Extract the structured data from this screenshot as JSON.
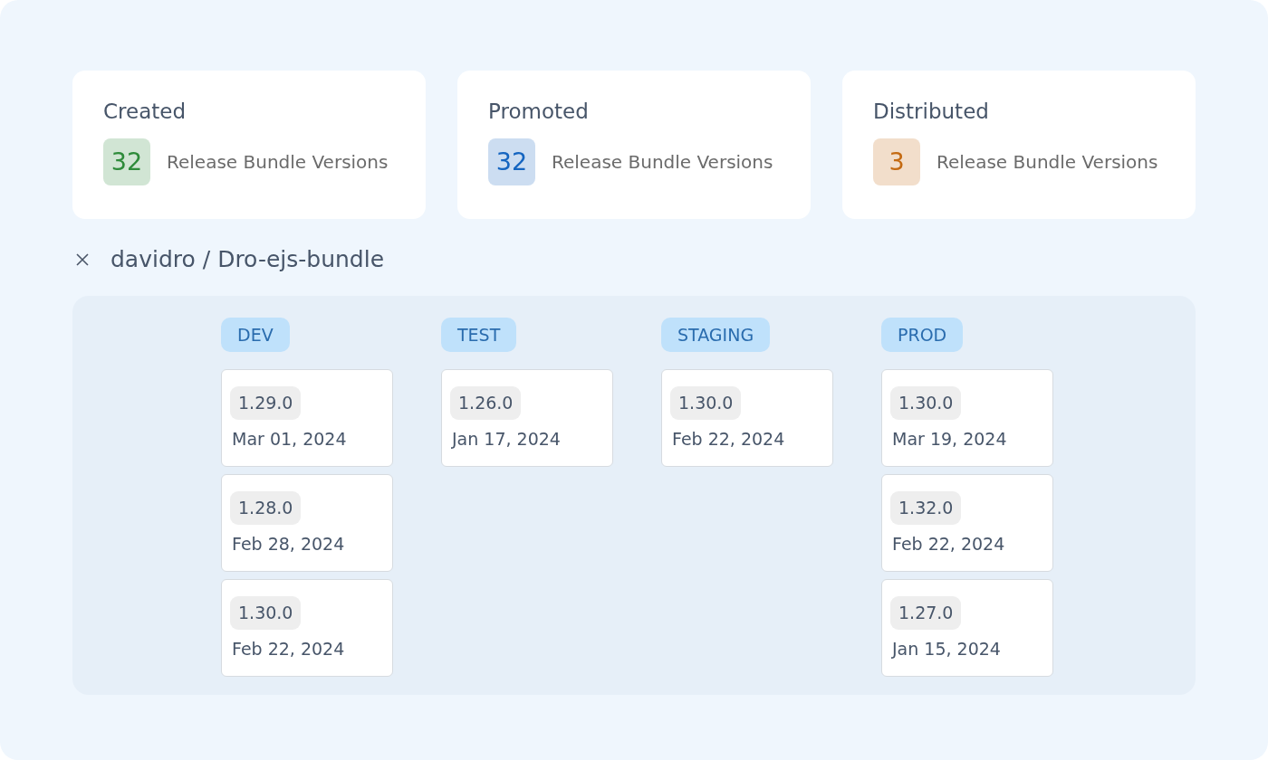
{
  "stats": [
    {
      "title": "Created",
      "count": "32",
      "color": "#2e8b3a",
      "label": "Release Bundle Versions"
    },
    {
      "title": "Promoted",
      "count": "32",
      "color": "#1565c0",
      "label": "Release Bundle Versions"
    },
    {
      "title": "Distributed",
      "count": "3",
      "color": "#c46a12",
      "label": "Release Bundle Versions"
    }
  ],
  "bundle": {
    "title": "davidro / Dro-ejs-bundle"
  },
  "stages": [
    {
      "name": "DEV",
      "versions": [
        {
          "version": "1.29.0",
          "date": "Mar 01, 2024"
        },
        {
          "version": "1.28.0",
          "date": "Feb 28, 2024"
        },
        {
          "version": "1.30.0",
          "date": "Feb 22, 2024"
        }
      ]
    },
    {
      "name": "TEST",
      "versions": [
        {
          "version": "1.26.0",
          "date": "Jan 17, 2024"
        }
      ]
    },
    {
      "name": "STAGING",
      "versions": [
        {
          "version": "1.30.0",
          "date": "Feb 22, 2024"
        }
      ]
    },
    {
      "name": "PROD",
      "versions": [
        {
          "version": "1.30.0",
          "date": "Mar 19, 2024"
        },
        {
          "version": "1.32.0",
          "date": "Feb 22, 2024"
        },
        {
          "version": "1.27.0",
          "date": "Jan 15, 2024"
        }
      ]
    }
  ]
}
